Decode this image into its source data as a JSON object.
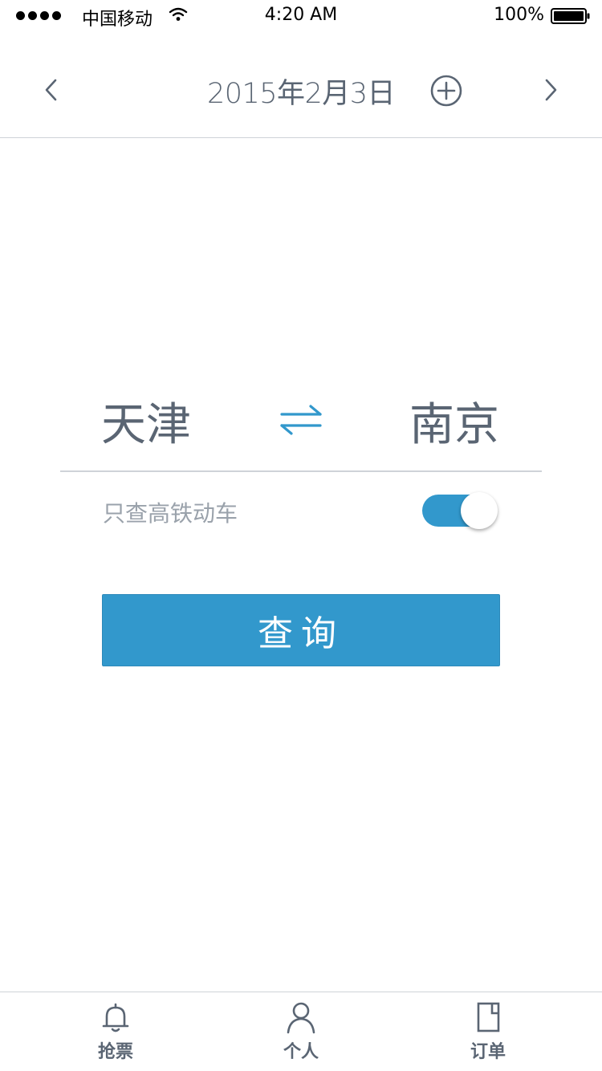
{
  "status_bar": {
    "carrier": "中国移动",
    "time": "4:20 AM",
    "battery": "100%"
  },
  "header": {
    "date": "2015年2月3日",
    "prev_icon": "chevron-left-icon",
    "next_icon": "chevron-right-icon",
    "add_icon": "plus-circle-icon"
  },
  "route": {
    "from": "天津",
    "to": "南京",
    "swap_icon": "swap-arrows-icon"
  },
  "filter": {
    "label": "只查高铁动车",
    "enabled": true
  },
  "query": {
    "label": "查询"
  },
  "tabs": [
    {
      "label": "抢票",
      "icon": "bell-icon"
    },
    {
      "label": "个人",
      "icon": "person-icon"
    },
    {
      "label": "订单",
      "icon": "document-icon"
    }
  ],
  "colors": {
    "accent": "#3298cc",
    "text": "#5a6573",
    "muted": "#9aa2ab",
    "divider": "#cfd3d8"
  }
}
